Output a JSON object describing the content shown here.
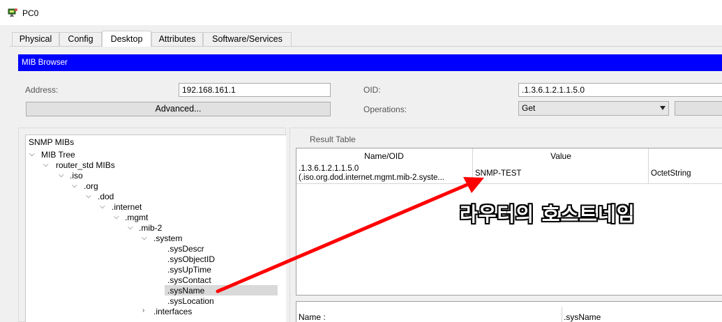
{
  "window": {
    "title": "PC0"
  },
  "tabs": [
    {
      "label": "Physical",
      "active": false
    },
    {
      "label": "Config",
      "active": false
    },
    {
      "label": "Desktop",
      "active": true
    },
    {
      "label": "Attributes",
      "active": false
    },
    {
      "label": "Software/Services",
      "active": false
    }
  ],
  "mib_browser": {
    "header": "MIB Browser",
    "address_label": "Address:",
    "address_value": "192.168.161.1",
    "advanced_button": "Advanced...",
    "oid_label": "OID:",
    "oid_value": ".1.3.6.1.2.1.1.5.0",
    "operations_label": "Operations:",
    "operations_value": "Get"
  },
  "tree": {
    "root_label": "SNMP MIBs",
    "items": [
      "MIB Tree",
      "router_std MIBs",
      ".iso",
      ".org",
      ".dod",
      ".internet",
      ".mgmt",
      ".mib-2",
      ".system",
      ".sysDescr",
      ".sysObjectID",
      ".sysUpTime",
      ".sysContact",
      ".sysName",
      ".sysLocation",
      ".interfaces"
    ],
    "selected": ".sysName"
  },
  "result_table": {
    "label": "Result Table",
    "columns": [
      "Name/OID",
      "Value"
    ],
    "rows": [
      {
        "oid": ".1.3.6.1.2.1.1.5.0",
        "name": "(.iso.org.dod.internet.mgmt.mib-2.syste...",
        "value": "SNMP-TEST",
        "type": "OctetString"
      }
    ]
  },
  "details": {
    "name_label": "Name :",
    "name_value": ".sysName"
  },
  "annotation": {
    "text": "라우터의 호스트네임",
    "arrow_color": "#ff0000"
  }
}
